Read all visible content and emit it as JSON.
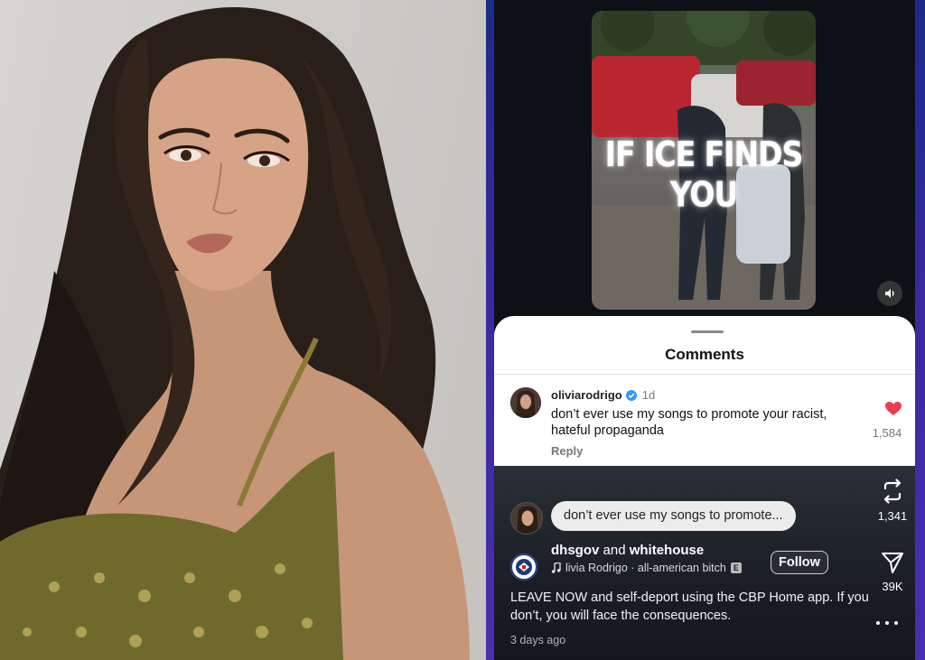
{
  "video": {
    "caption": "IF ICE FINDS YOU",
    "mute_icon": "speaker-icon"
  },
  "comments_sheet": {
    "title": "Comments",
    "comment": {
      "username": "oliviarodrigo",
      "verified_icon": "verified-badge-icon",
      "age": "1d",
      "text": "don’t ever use my songs to promote your racist, hateful propaganda",
      "reply_label": "Reply",
      "like_icon": "heart-icon",
      "like_count": "1,584"
    }
  },
  "reel": {
    "quoted_comment": "don’t ever use my songs to promote...",
    "account_primary": "dhsgov",
    "account_joiner": "and",
    "account_secondary": "whitehouse",
    "audio": "livia Rodrigo · all-american bitch",
    "audio_partial_glyph": "E",
    "follow_label": "Follow",
    "caption": "LEAVE NOW and self-deport using the CBP Home app. If you don’t, you will face the consequences.",
    "timestamp": "3 days ago",
    "repost_count": "1,341",
    "share_count": "39K"
  },
  "colors": {
    "like_red": "#ed3b4f",
    "verified_blue": "#3897f0",
    "sheet_bg": "#ffffff",
    "reel_bg": "#1b1f26"
  }
}
